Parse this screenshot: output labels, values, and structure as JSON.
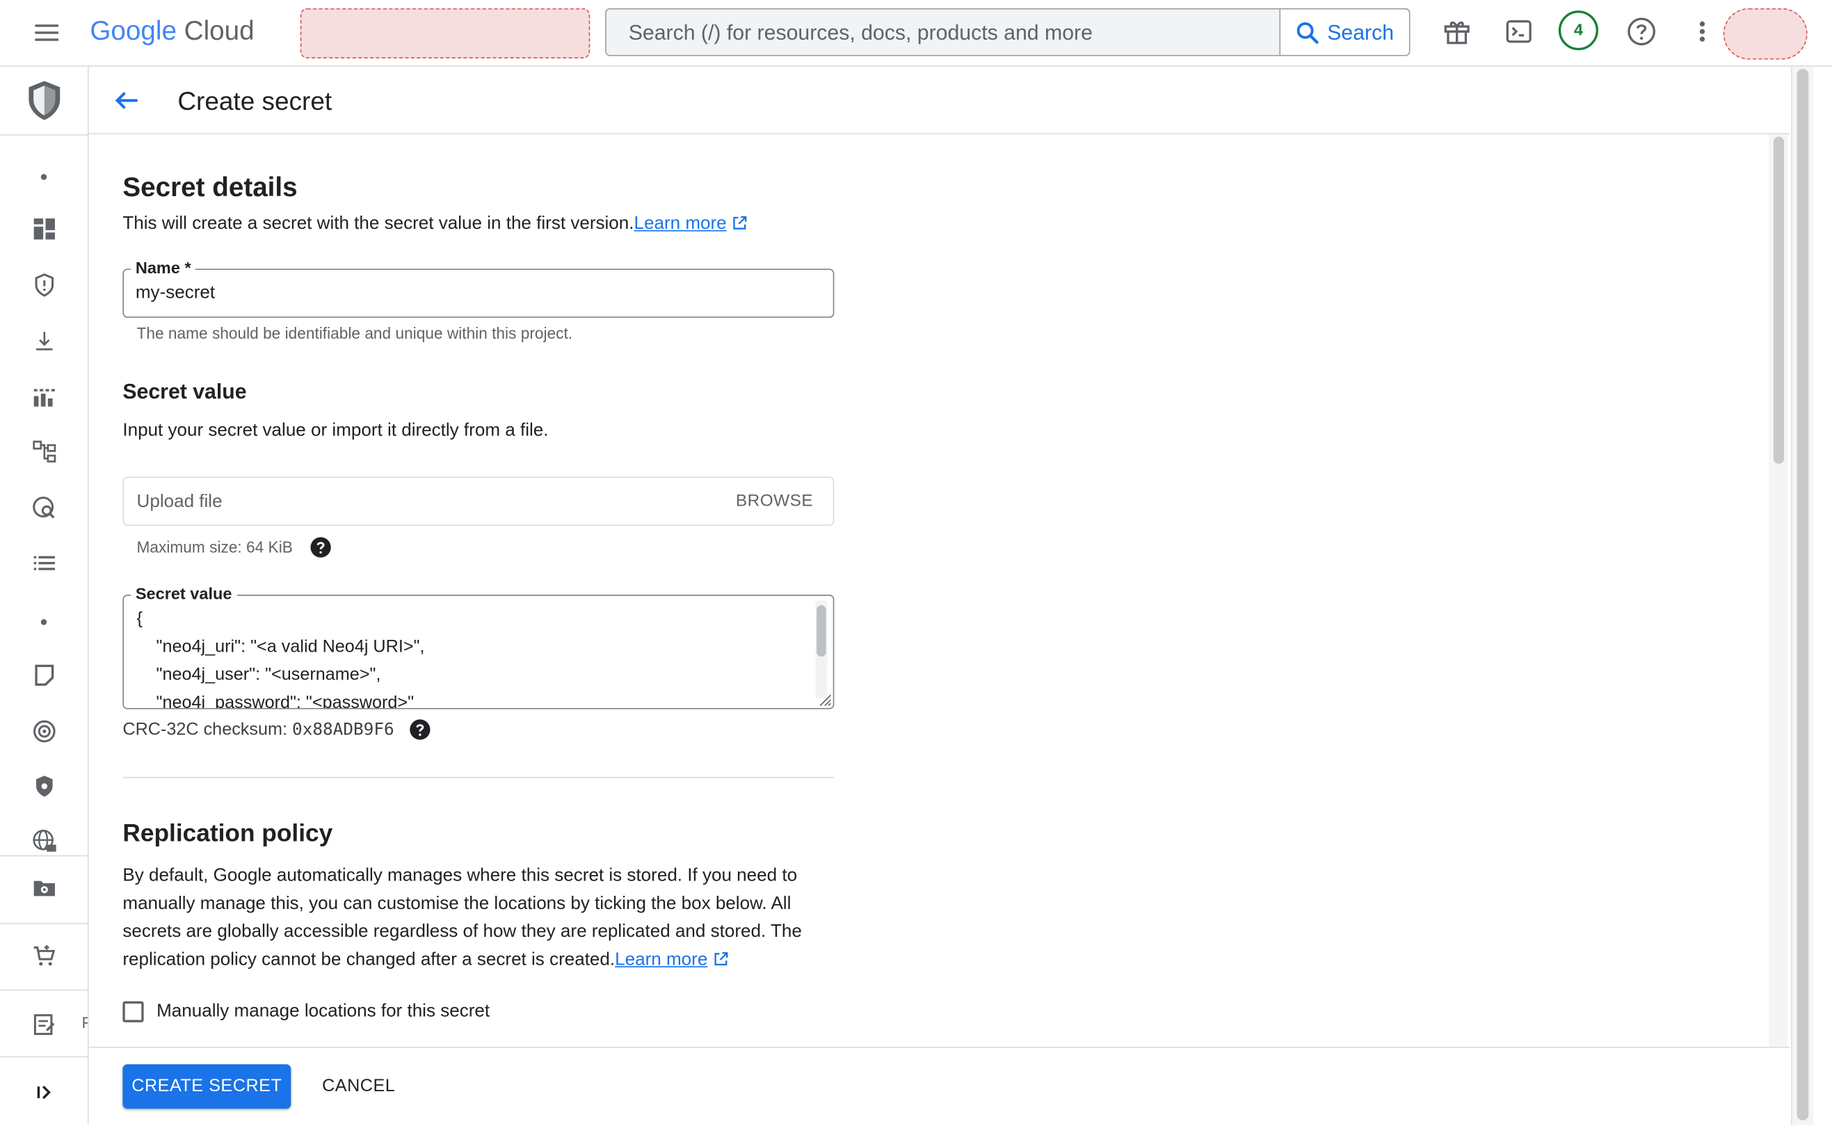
{
  "topbar": {
    "brand_google": "Google",
    "brand_cloud": "Cloud",
    "search_placeholder": "Search (/) for resources, docs, products and more",
    "search_button": "Search",
    "notification_count": "4"
  },
  "page": {
    "title": "Create secret"
  },
  "secret_details": {
    "heading": "Secret details",
    "description": "This will create a secret with the secret value in the first version.",
    "learn_more": "Learn more",
    "name_label": "Name *",
    "name_value": "my-secret",
    "name_hint": "The name should be identifiable and unique within this project."
  },
  "secret_value": {
    "heading": "Secret value",
    "description": "Input your secret value or import it directly from a file.",
    "upload_placeholder": "Upload file",
    "browse_button": "BROWSE",
    "max_size": "Maximum size: 64 KiB",
    "textarea_label": "Secret value",
    "textarea_value": "{\n    \"neo4j_uri\": \"<a valid Neo4j URI>\",\n    \"neo4j_user\": \"<username>\",\n    \"neo4j_password\": \"<password>\"",
    "checksum_label": "CRC-32C checksum:",
    "checksum_value": "0x88ADB9F6"
  },
  "replication": {
    "heading": "Replication policy",
    "description": "By default, Google automatically manages where this secret is stored. If you need to manually manage this, you can customise the locations by ticking the box below. All secrets are globally accessible regardless of how they are replicated and stored. The replication policy cannot be changed after a secret is created.",
    "learn_more": "Learn more",
    "checkbox_label": "Manually manage locations for this secret",
    "checkbox_checked": false
  },
  "footer": {
    "create_button": "CREATE SECRET",
    "cancel_button": "CANCEL"
  },
  "colors": {
    "accent": "#1a73e8",
    "success": "#188038"
  }
}
